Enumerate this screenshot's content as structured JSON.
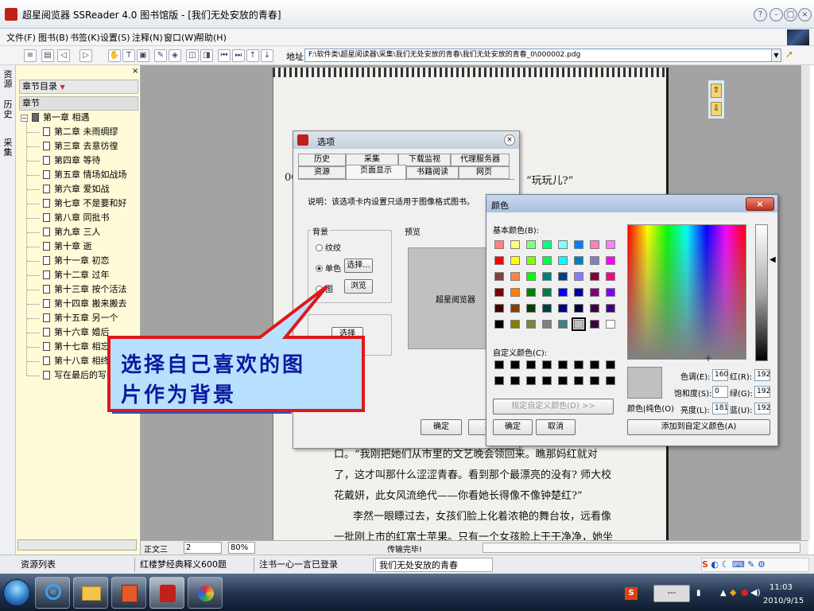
{
  "window": {
    "title": "超星阅览器 SSReader 4.0 图书馆版 - [我们无处安放的青春]"
  },
  "menu": [
    "文件(F)",
    "图书(B)",
    "书签(K)",
    "设置(S)",
    "注释(N)",
    "窗口(W)",
    "帮助(H)"
  ],
  "address": {
    "label": "地址:",
    "value": "F:\\软件类\\超星阅读器\\采集\\我们无处安放的青春\\我们无处安放的青春_0\\000002.pdg"
  },
  "vertical_tabs": [
    "资源",
    "历史",
    "采集"
  ],
  "sidebar": {
    "header": "章节目录",
    "section_header": "章节",
    "root": "第一章 相遇",
    "items": [
      "第二章 未雨绸缪",
      "第三章 去意彷徨",
      "第四章 等待",
      "第五章 情场如战场",
      "第六章 爱如战",
      "第七章 不是要和好",
      "第八章 同批书",
      "第九章 三人",
      "第十章 逝",
      "第十一章 初恋",
      "第十二章 过年",
      "第十三章 按个活法",
      "第十四章 搬来搬去",
      "第十五章 另一个",
      "第十六章 婚后",
      "第十七章 相忘遇",
      "第十八章 相终久老",
      "写在最后的写作"
    ]
  },
  "page_text": {
    "top_left": "00",
    "quote": "“玩玩儿?”",
    "lines": [
      "口。“我刚把她们从市里的文艺晚会领回来。瞧那妈红就对",
      "了，这才叫那什么涩涩青春。看到那个最漂亮的没有? 师大校",
      "花戴妍，此女风流绝代——你看她长得像不像钟楚红?”",
      "李然一眼瞟过去，女孩们脸上化着浓艳的舞台妆，远看像",
      "一批刚上市的红富士苹果。只有一个女孩脸上干干净净，她坐"
    ]
  },
  "options_dialog": {
    "title": "选项",
    "tabs_row1": [
      "历史",
      "采集",
      "下载监视",
      "代理服务器"
    ],
    "tabs_row2": [
      "资源",
      "页面显示",
      "书籍阅读",
      "网页"
    ],
    "description": "说明：该选项卡内设置只适用于图像格式图书。",
    "bg_group_label": "背景",
    "radio_texture": "纹绞",
    "radio_solid": "单色",
    "choose_button": "选择...",
    "radio_image": "图",
    "browse_button": "浏览",
    "preview_group_label": "预览",
    "preview_text": "超星阅览器",
    "other_choose_button": "选择",
    "ok_button": "确定",
    "cancel_button": "取"
  },
  "color_dialog": {
    "title": "颜色",
    "basic_colors_label": "基本颜色(B):",
    "custom_colors_label": "自定义颜色(C):",
    "define_custom_button": "规定自定义颜色(D) >>",
    "ok_button": "确定",
    "cancel_button": "取消",
    "add_custom_button": "添加到自定义颜色(A)",
    "color_solid_label": "颜色|纯色(O)",
    "hue_label": "色调(E):",
    "hue_value": "160",
    "sat_label": "饱和度(S):",
    "sat_value": "0",
    "lum_label": "亮度(L):",
    "lum_value": "181",
    "red_label": "红(R):",
    "red_value": "192",
    "green_label": "绿(G):",
    "green_value": "192",
    "blue_label": "蓝(U):",
    "blue_value": "192",
    "basic_colors": [
      "#ff8080",
      "#ffff80",
      "#80ff80",
      "#00ff80",
      "#80ffff",
      "#0080ff",
      "#ff80c0",
      "#ff80ff",
      "#ff0000",
      "#ffff00",
      "#80ff00",
      "#00ff40",
      "#00ffff",
      "#0080c0",
      "#8080c0",
      "#ff00ff",
      "#804040",
      "#ff8040",
      "#00ff00",
      "#008080",
      "#004080",
      "#8080ff",
      "#800040",
      "#ff0080",
      "#800000",
      "#ff8000",
      "#008000",
      "#008040",
      "#0000ff",
      "#0000a0",
      "#800080",
      "#8000ff",
      "#400000",
      "#804000",
      "#004000",
      "#004040",
      "#000080",
      "#000040",
      "#400040",
      "#400080",
      "#000000",
      "#808000",
      "#808040",
      "#808080",
      "#408080",
      "#c0c0c0",
      "#400040",
      "#ffffff"
    ]
  },
  "callout": {
    "line1": "选择自己喜欢的图",
    "line2": "片作为背景"
  },
  "status": {
    "zoom_label": "正文三",
    "page_value": "2",
    "zoom_value": "80%",
    "message": "传输完毕!"
  },
  "doc_tabs": [
    "资源列表",
    "红楼梦经典释义600题",
    "注书一心一言已登录",
    "我们无处安放的青春"
  ],
  "clock": {
    "time": "11:03",
    "date": "2010/9/15"
  }
}
